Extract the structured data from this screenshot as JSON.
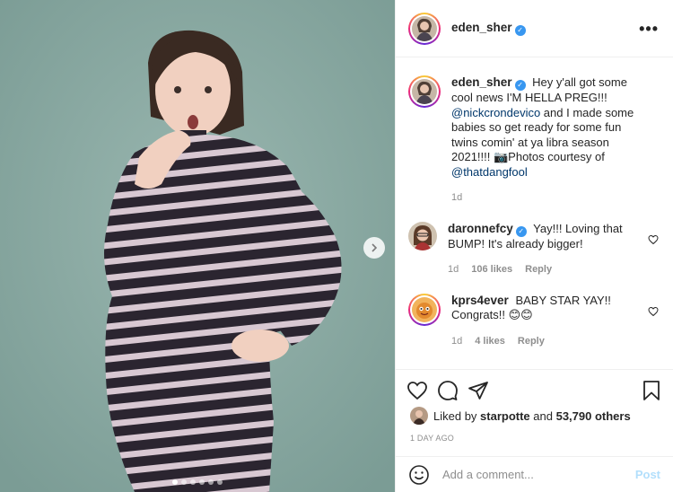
{
  "post": {
    "image_dots_total": 6,
    "image_dots_active": 1
  },
  "header": {
    "username": "eden_sher",
    "verified": true,
    "more_label": "•••"
  },
  "caption": {
    "username": "eden_sher",
    "text_1": "Hey y'all got some cool news I'M HELLA PREG!!!",
    "mention_1": "@nickcrondevico",
    "text_2": " and I made some babies so get ready for some fun twins comin' at ya libra season 2021!!!! ",
    "camera_emoji": "📷",
    "text_3": "Photos courtesy of ",
    "mention_2": "@thatdangfool",
    "time": "1d"
  },
  "comments": [
    {
      "username": "daronnefcy",
      "verified": true,
      "text": "Yay!!! Loving that BUMP! It's already bigger!",
      "time": "1d",
      "likes": "106 likes",
      "reply": "Reply"
    },
    {
      "username": "kprs4ever",
      "verified": false,
      "text": "BABY STAR YAY!! Congrats!! ",
      "emoji": "😊😊",
      "time": "1d",
      "likes": "4 likes",
      "reply": "Reply"
    }
  ],
  "likes": {
    "prefix": "Liked by ",
    "user": "starpotte",
    "middle": " and ",
    "count": "53,790 others"
  },
  "timestamp": "1 DAY AGO",
  "add_comment": {
    "placeholder": "Add a comment...",
    "post_label": "Post"
  },
  "colors": {
    "photo_background": "#8aaaa3",
    "link": "#00376b",
    "verified": "#3897f0",
    "post_disabled": "#b2dffc"
  },
  "icons": {
    "next": "chevron-right-icon",
    "like": "heart-icon",
    "comment": "comment-bubble-icon",
    "share": "paper-plane-icon",
    "save": "bookmark-icon",
    "emoji": "smiley-icon"
  }
}
